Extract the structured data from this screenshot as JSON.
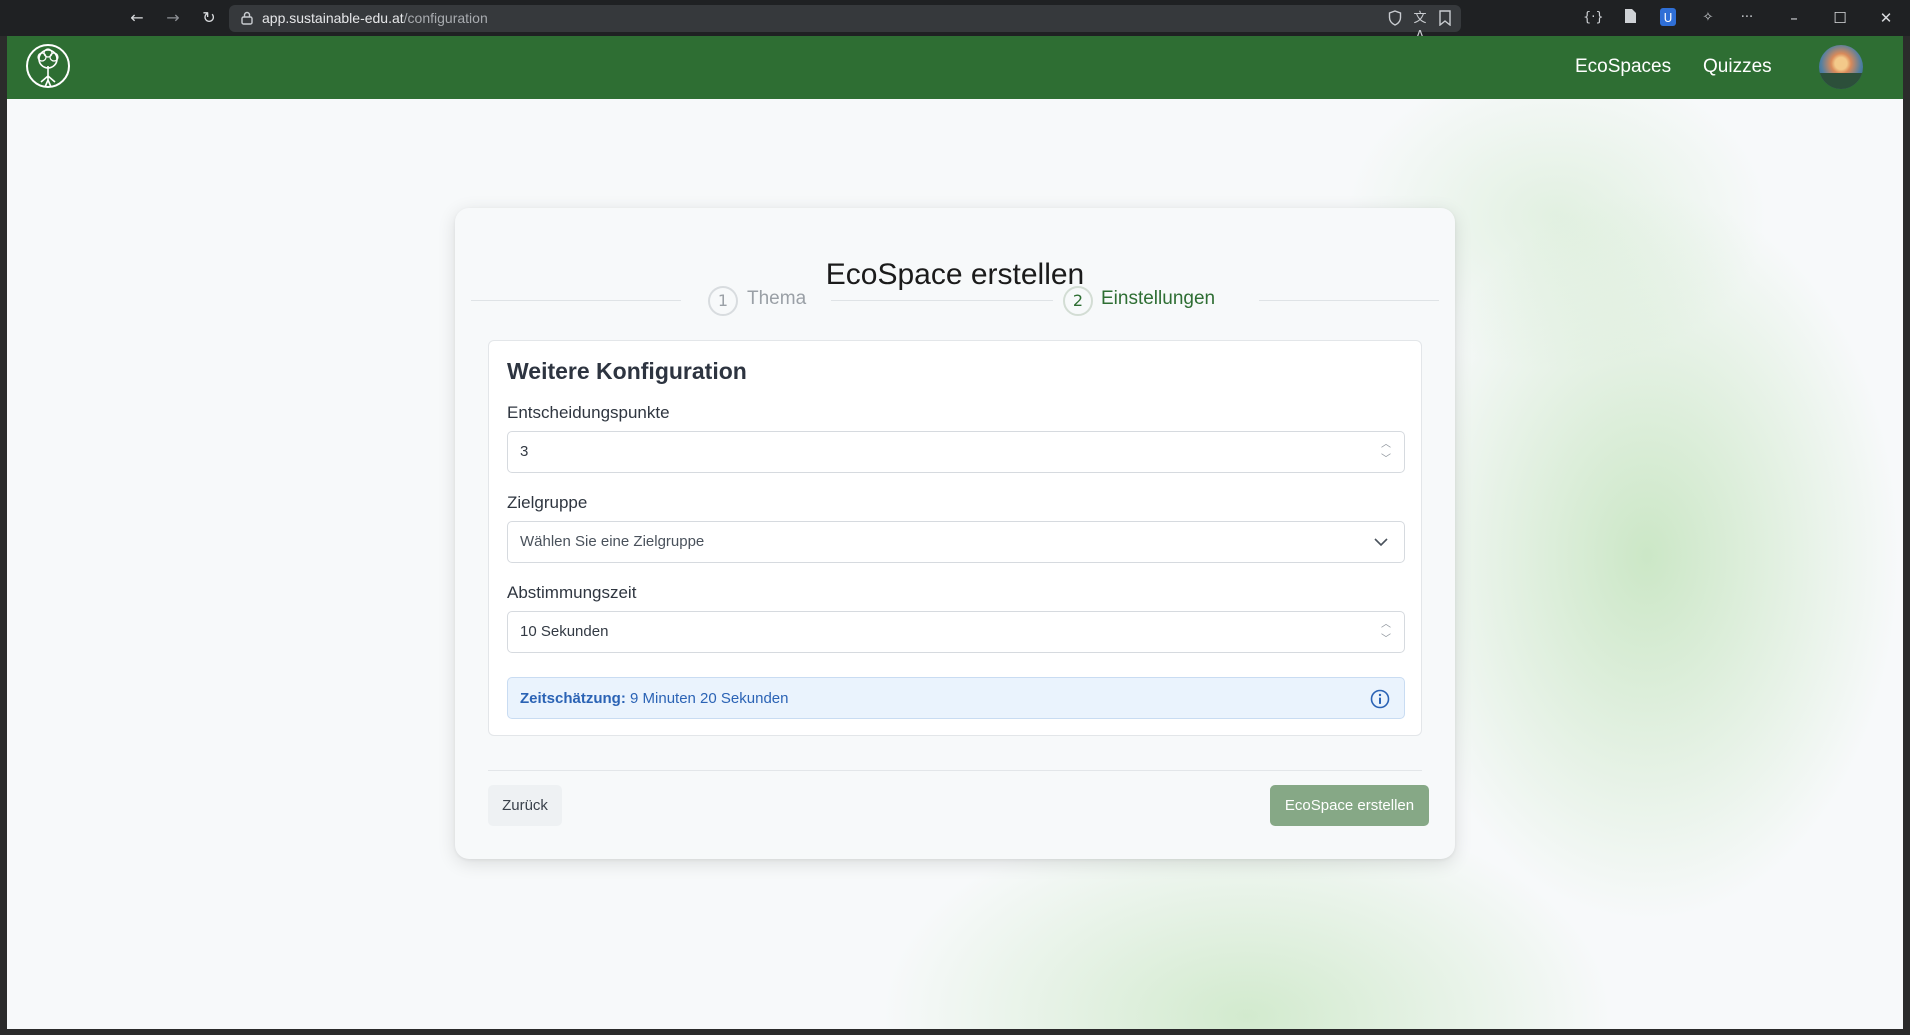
{
  "browser": {
    "url_host": "app.sustainable-edu.at",
    "url_path": "/configuration",
    "icons": [
      "back-icon",
      "forward-icon",
      "reload-icon",
      "lock-icon",
      "shield-icon",
      "translate-icon",
      "bookmark-icon",
      "devtools-icon",
      "reader-icon",
      "extension-icon",
      "puzzle-icon",
      "more-icon"
    ],
    "window": {
      "minimize": "–",
      "maximize": "☐",
      "close": "✕"
    }
  },
  "header": {
    "nav": [
      "EcoSpaces",
      "Quizzes"
    ],
    "brand_color": "#2e6e33"
  },
  "card": {
    "title": "EcoSpace erstellen",
    "steps": [
      {
        "number": "1",
        "label": "Thema",
        "active": false
      },
      {
        "number": "2",
        "label": "Einstellungen",
        "active": true
      }
    ],
    "section_title": "Weitere Konfiguration",
    "fields": {
      "decision_points": {
        "label": "Entscheidungspunkte",
        "value": "3"
      },
      "target_group": {
        "label": "Zielgruppe",
        "placeholder": "Wählen Sie eine Zielgruppe"
      },
      "voting_time": {
        "label": "Abstimmungszeit",
        "value": "10 Sekunden"
      }
    },
    "estimate": {
      "label": "Zeitschätzung:",
      "value": "9 Minuten 20 Sekunden"
    },
    "buttons": {
      "back": "Zurück",
      "create": "EcoSpace erstellen"
    }
  }
}
